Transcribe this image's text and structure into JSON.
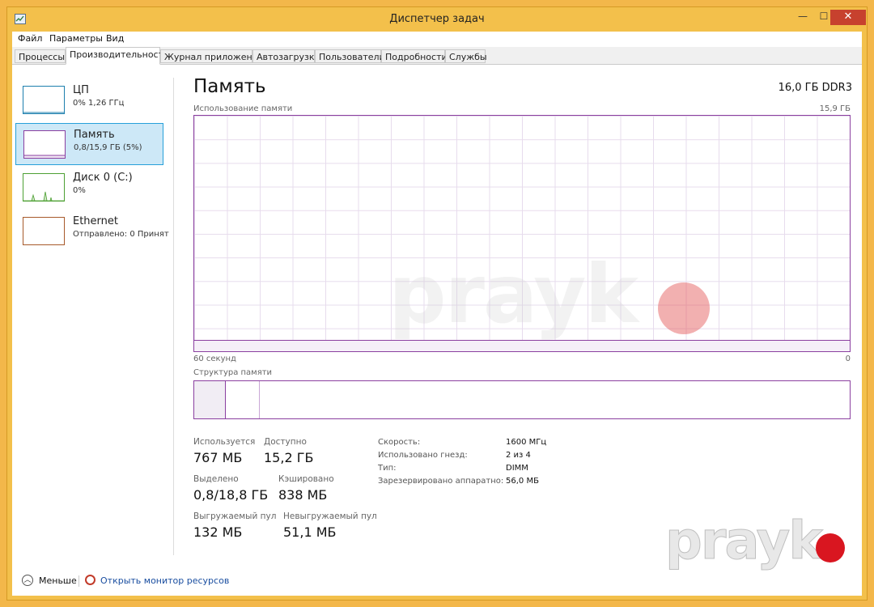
{
  "window": {
    "title": "Диспетчер задач",
    "controls": {
      "minimize": "—",
      "maximize": "☐",
      "close": "✕"
    }
  },
  "menu": [
    "Файл",
    "Параметры",
    "Вид"
  ],
  "tabs": [
    "Процессы",
    "Производительность",
    "Журнал приложений",
    "Автозагрузка",
    "Пользователи",
    "Подробности",
    "Службы"
  ],
  "active_tab": "Производительность",
  "sidebar": {
    "items": [
      {
        "name": "ЦП",
        "sub": "0% 1,26 ГГц",
        "color": "#1c7fae"
      },
      {
        "name": "Память",
        "sub": "0,8/15,9 ГБ (5%)",
        "color": "#8b3fa0",
        "selected": true
      },
      {
        "name": "Диск 0 (C:)",
        "sub": "0%",
        "color": "#4da033"
      },
      {
        "name": "Ethernet",
        "sub": "Отправлено: 0 Принят",
        "color": "#a7592a"
      }
    ]
  },
  "main": {
    "title": "Память",
    "spec": "16,0 ГБ DDR3",
    "usage_label": "Использование памяти",
    "usage_max": "15,9 ГБ",
    "x_left": "60 секунд",
    "x_right": "0",
    "structure_label": "Структура памяти",
    "stats": {
      "in_use_label": "Используется",
      "in_use": "767 МБ",
      "available_label": "Доступно",
      "available": "15,2 ГБ",
      "committed_label": "Выделено",
      "committed": "0,8/18,8 ГБ",
      "cached_label": "Кэшировано",
      "cached": "838 МБ",
      "paged_label": "Выгружаемый пул",
      "paged": "132 МБ",
      "nonpaged_label": "Невыгружаемый пул",
      "nonpaged": "51,1 МБ"
    },
    "specs": {
      "speed_label": "Скорость:",
      "speed": "1600 МГц",
      "slots_label": "Использовано гнезд:",
      "slots": "2 из 4",
      "form_label": "Тип:",
      "form": "DIMM",
      "reserved_label": "Зарезервировано аппаратно:",
      "reserved": "56,0 МБ"
    }
  },
  "footer": {
    "fewer_details": "Меньше",
    "resource_monitor": "Открыть монитор ресурсов"
  },
  "watermark": "prayk",
  "colors": {
    "accent": "#8b3fa0",
    "frame": "#f3c04b",
    "selected_bg": "#cde8f7",
    "close": "#c7412e"
  }
}
